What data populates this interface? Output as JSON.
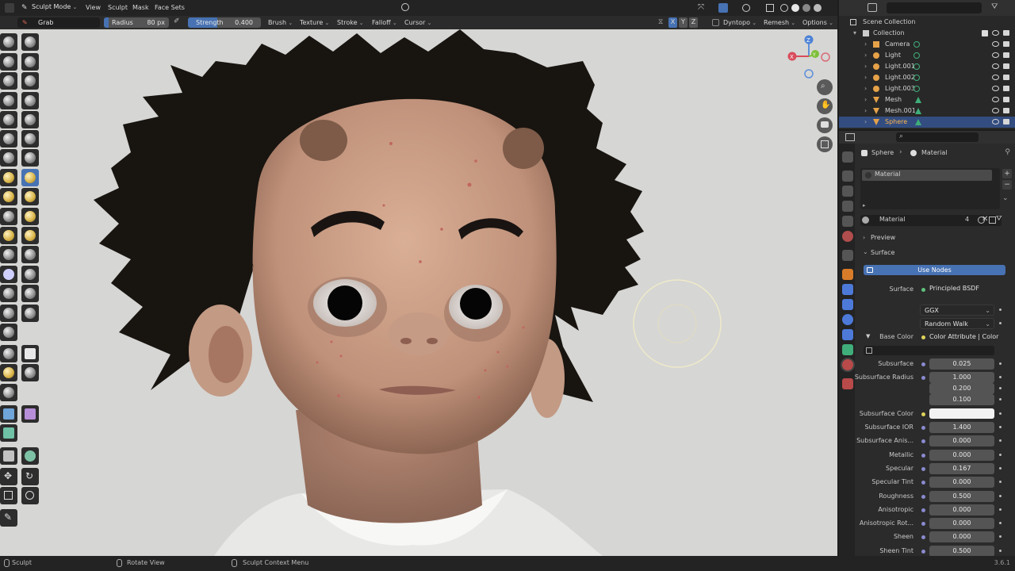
{
  "header": {
    "mode": "Sculpt Mode",
    "menus": [
      "View",
      "Sculpt",
      "Mask",
      "Face Sets"
    ],
    "tool_name": "Grab",
    "radius_label": "Radius",
    "radius_value": "80 px",
    "strength_label": "Strength",
    "strength_value": "0.400",
    "strength_fraction": 0.4,
    "tool_menus": [
      "Brush",
      "Texture",
      "Stroke",
      "Falloff",
      "Cursor"
    ],
    "axes": [
      "X",
      "Y",
      "Z"
    ],
    "dyntopo": "Dyntopo",
    "remesh": "Remesh",
    "options": "Options"
  },
  "gizmo": {
    "x": "X",
    "y": "Y",
    "z": "Z"
  },
  "outliner": {
    "root": "Scene Collection",
    "collection": "Collection",
    "items": [
      {
        "name": "Camera",
        "type": "camera"
      },
      {
        "name": "Light",
        "type": "light"
      },
      {
        "name": "Light.001",
        "type": "light"
      },
      {
        "name": "Light.002",
        "type": "light"
      },
      {
        "name": "Light.003",
        "type": "light"
      },
      {
        "name": "Mesh",
        "type": "mesh"
      },
      {
        "name": "Mesh.001",
        "type": "mesh"
      },
      {
        "name": "Sphere",
        "type": "mesh",
        "active": true
      }
    ]
  },
  "properties": {
    "breadcrumb_object": "Sphere",
    "breadcrumb_tab": "Material",
    "slot_name": "Material",
    "material_name": "Material",
    "users": "4",
    "preview_label": "Preview",
    "surface_panel": "Surface",
    "use_nodes": "Use Nodes",
    "surface_label": "Surface",
    "surface_value": "Principled BSDF",
    "distribution": "GGX",
    "subsurface_method": "Random Walk",
    "base_color_label": "Base Color",
    "base_color_value": "Color Attribute | Color",
    "rows": [
      {
        "label": "Subsurface",
        "value": "0.025",
        "fill": 0.025
      },
      {
        "label": "Subsurface Radius",
        "value": "1.000",
        "fill": 0
      },
      {
        "label": "",
        "value": "0.200",
        "fill": 0
      },
      {
        "label": "",
        "value": "0.100",
        "fill": 0
      }
    ],
    "subsurface_color_label": "Subsurface Color",
    "subsurface_color": "#f2f2f2",
    "rows2": [
      {
        "label": "Subsurface IOR",
        "value": "1.400",
        "fill": 0.1
      },
      {
        "label": "Subsurface Anis...",
        "value": "0.000",
        "fill": 0
      },
      {
        "label": "Metallic",
        "value": "0.000",
        "fill": 0
      },
      {
        "label": "Specular",
        "value": "0.167",
        "fill": 0.167
      },
      {
        "label": "Specular Tint",
        "value": "0.000",
        "fill": 0
      },
      {
        "label": "Roughness",
        "value": "0.500",
        "fill": 0.5
      },
      {
        "label": "Anisotropic",
        "value": "0.000",
        "fill": 0
      },
      {
        "label": "Anisotropic Rot...",
        "value": "0.000",
        "fill": 0
      },
      {
        "label": "Sheen",
        "value": "0.000",
        "fill": 0
      },
      {
        "label": "Sheen Tint",
        "value": "0.500",
        "fill": 0.5
      }
    ]
  },
  "status": {
    "left": "Sculpt",
    "middle": "Rotate View",
    "right": "Sculpt Context Menu",
    "version": "3.6.1"
  },
  "colors": {
    "accent": "#4772b3",
    "viewport_bg": "#d6d6d4",
    "hair": "#181410",
    "skin": "#c89c82"
  }
}
